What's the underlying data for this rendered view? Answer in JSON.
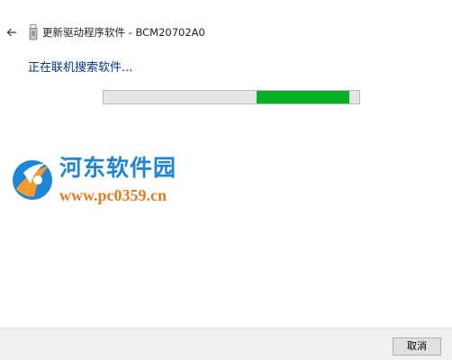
{
  "header": {
    "back_icon": "back-arrow-icon",
    "device_icon": "usb-device-icon",
    "title": "更新驱动程序软件 - BCM20702A0"
  },
  "main": {
    "status": "正在联机搜索软件...",
    "progress": {
      "indeterminate": true,
      "segment_start": 0.6,
      "segment_end": 0.96,
      "fill_color": "#06b025",
      "track_color": "#e6e6e6"
    }
  },
  "watermark": {
    "logo_icon": "pc0359-logo-icon",
    "title": "河东软件园",
    "url": "www.pc0359.cn",
    "title_color": "#1f86d6",
    "url_color": "#e87b1b"
  },
  "footer": {
    "cancel_label": "取消"
  }
}
